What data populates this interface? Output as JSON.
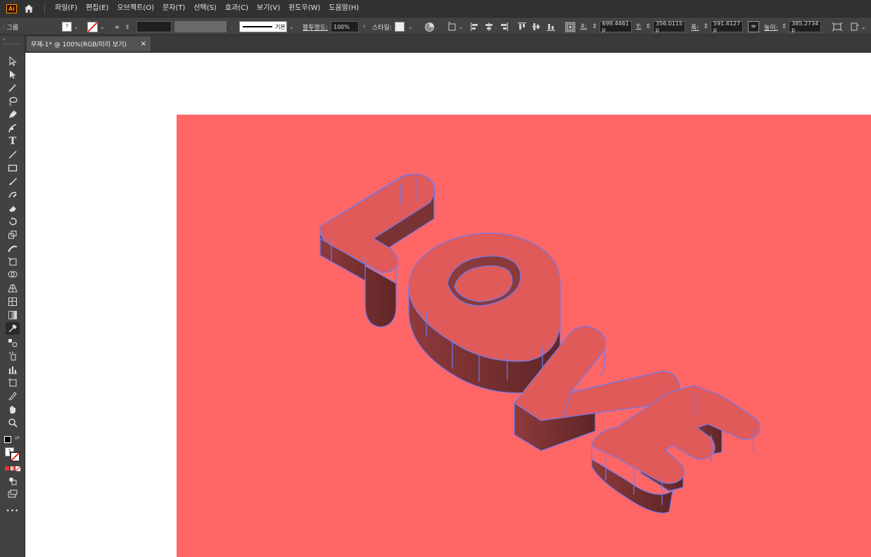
{
  "app": {
    "logo_text": "Ai"
  },
  "menu": {
    "items": [
      "파일(F)",
      "편집(E)",
      "오브젝트(O)",
      "문자(T)",
      "선택(S)",
      "효과(C)",
      "보기(V)",
      "윈도우(W)",
      "도움말(H)"
    ]
  },
  "control": {
    "group_label": "그룹",
    "stroke_style_label": "기본",
    "opacity_label": "불투명도:",
    "opacity_value": "100%",
    "style_label": "스타일:",
    "x_label": "X:",
    "x_value": "699.4461 p",
    "y_label": "Y:",
    "y_value": "356.0115 p",
    "width_label": "폭:",
    "width_value": "591.4127 p",
    "height_label": "높이:",
    "height_value": "385.2734 p"
  },
  "document": {
    "tab_title": "무제-1* @ 100%(RGB/미리 보기)",
    "close_glyph": "×"
  },
  "toolbar": {
    "more_glyph": "•••"
  },
  "colors": {
    "artboard": "#ff6666",
    "selection": "#6c7cf0",
    "extrude_dark": "#7a3334",
    "face": "#e05a5a",
    "chrome": "#424242"
  },
  "artwork": {
    "text": "LOVE"
  }
}
